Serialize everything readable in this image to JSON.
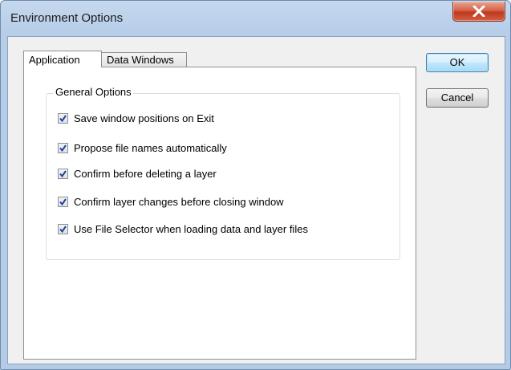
{
  "window": {
    "title": "Environment Options",
    "accent": "#c0391f"
  },
  "tabs": [
    {
      "label": "Application",
      "selected": true
    },
    {
      "label": "Data Windows",
      "selected": false
    }
  ],
  "general_options": {
    "legend": "General Options",
    "items": [
      {
        "label": "Save window positions on Exit",
        "checked": true
      },
      {
        "label": "Propose file names automatically",
        "checked": true
      },
      {
        "label": "Confirm before deleting a layer",
        "checked": true
      },
      {
        "label": "Confirm layer changes before closing window",
        "checked": true
      },
      {
        "label": "Use File Selector when loading data and layer files",
        "checked": true
      }
    ]
  },
  "buttons": {
    "ok_label": "OK",
    "cancel_label": "Cancel"
  },
  "icons": {
    "close": "close-x-icon",
    "check": "checkmark-icon"
  }
}
